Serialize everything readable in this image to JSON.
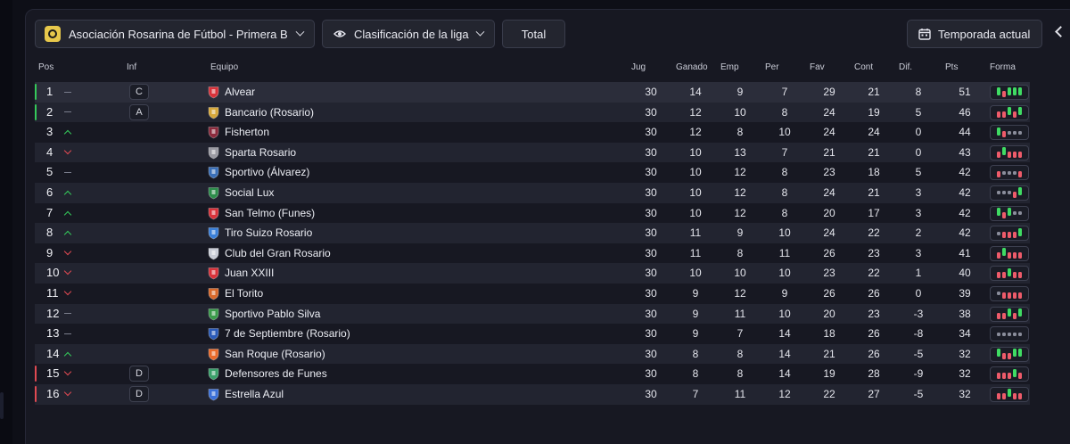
{
  "toolbar": {
    "league": "Asociación Rosarina de Fútbol - Primera B",
    "classification": "Clasificación de la liga",
    "total": "Total",
    "season": "Temporada actual"
  },
  "headers": {
    "pos": "Pos",
    "inf": "Inf",
    "team": "Equipo",
    "played": "Jug",
    "won": "Ganado",
    "drawn": "Emp",
    "lost": "Per",
    "gf": "Fav",
    "ga": "Cont",
    "gd": "Dif.",
    "pts": "Pts",
    "form": "Forma"
  },
  "colors": {
    "win": "#3fdc63",
    "loss": "#ee5b6a",
    "draw": "#8a8d9b",
    "promotion": "#35c95a",
    "relegation": "#e04a52"
  },
  "rows": [
    {
      "pos": "1",
      "trend": "same",
      "inf": "C",
      "team": "Alvear",
      "crest": "#d8323a",
      "jug": "30",
      "g": "14",
      "e": "9",
      "p": "7",
      "fav": "29",
      "cont": "21",
      "dif": "8",
      "pts": "51",
      "form": "WLWWW",
      "zone": "green"
    },
    {
      "pos": "2",
      "trend": "same",
      "inf": "A",
      "team": "Bancario (Rosario)",
      "crest": "#d6a73a",
      "jug": "30",
      "g": "12",
      "e": "10",
      "p": "8",
      "fav": "24",
      "cont": "19",
      "dif": "5",
      "pts": "46",
      "form": "LLWLW",
      "zone": "green"
    },
    {
      "pos": "3",
      "trend": "up",
      "inf": "",
      "team": "Fisherton",
      "crest": "#8b2a3c",
      "jug": "30",
      "g": "12",
      "e": "8",
      "p": "10",
      "fav": "24",
      "cont": "24",
      "dif": "0",
      "pts": "44",
      "form": "WLDDD",
      "zone": ""
    },
    {
      "pos": "4",
      "trend": "down",
      "inf": "",
      "team": "Sparta Rosario",
      "crest": "#9a9aa2",
      "jug": "30",
      "g": "10",
      "e": "13",
      "p": "7",
      "fav": "21",
      "cont": "21",
      "dif": "0",
      "pts": "43",
      "form": "LWLLL",
      "zone": ""
    },
    {
      "pos": "5",
      "trend": "same",
      "inf": "",
      "team": "Sportivo (Álvarez)",
      "crest": "#3a6fb8",
      "jug": "30",
      "g": "10",
      "e": "12",
      "p": "8",
      "fav": "23",
      "cont": "18",
      "dif": "5",
      "pts": "42",
      "form": "LDDDL",
      "zone": ""
    },
    {
      "pos": "6",
      "trend": "up",
      "inf": "",
      "team": "Social Lux",
      "crest": "#2c8c4a",
      "jug": "30",
      "g": "10",
      "e": "12",
      "p": "8",
      "fav": "24",
      "cont": "21",
      "dif": "3",
      "pts": "42",
      "form": "DDDLW",
      "zone": ""
    },
    {
      "pos": "7",
      "trend": "up",
      "inf": "",
      "team": "San Telmo (Funes)",
      "crest": "#d8323a",
      "jug": "30",
      "g": "10",
      "e": "12",
      "p": "8",
      "fav": "20",
      "cont": "17",
      "dif": "3",
      "pts": "42",
      "form": "WLWDD",
      "zone": ""
    },
    {
      "pos": "8",
      "trend": "up",
      "inf": "",
      "team": "Tiro Suizo Rosario",
      "crest": "#3a7fd8",
      "jug": "30",
      "g": "11",
      "e": "9",
      "p": "10",
      "fav": "24",
      "cont": "22",
      "dif": "2",
      "pts": "42",
      "form": "DLLLW",
      "zone": ""
    },
    {
      "pos": "9",
      "trend": "down",
      "inf": "",
      "team": "Club del Gran Rosario",
      "crest": "#c9ccd6",
      "jug": "30",
      "g": "11",
      "e": "8",
      "p": "11",
      "fav": "26",
      "cont": "23",
      "dif": "3",
      "pts": "41",
      "form": "LWLLL",
      "zone": ""
    },
    {
      "pos": "10",
      "trend": "down",
      "inf": "",
      "team": "Juan XXIII",
      "crest": "#d8323a",
      "jug": "30",
      "g": "10",
      "e": "10",
      "p": "10",
      "fav": "23",
      "cont": "22",
      "dif": "1",
      "pts": "40",
      "form": "LLWLL",
      "zone": ""
    },
    {
      "pos": "11",
      "trend": "down",
      "inf": "",
      "team": "El Torito",
      "crest": "#d8682a",
      "jug": "30",
      "g": "9",
      "e": "12",
      "p": "9",
      "fav": "26",
      "cont": "26",
      "dif": "0",
      "pts": "39",
      "form": "DLLLL",
      "zone": ""
    },
    {
      "pos": "12",
      "trend": "same",
      "inf": "",
      "team": "Sportivo Pablo Silva",
      "crest": "#3a9a4a",
      "jug": "30",
      "g": "9",
      "e": "11",
      "p": "10",
      "fav": "20",
      "cont": "23",
      "dif": "-3",
      "pts": "38",
      "form": "LLWLW",
      "zone": ""
    },
    {
      "pos": "13",
      "trend": "same",
      "inf": "",
      "team": "7 de Septiembre (Rosario)",
      "crest": "#2a5ab8",
      "jug": "30",
      "g": "9",
      "e": "7",
      "p": "14",
      "fav": "18",
      "cont": "26",
      "dif": "-8",
      "pts": "34",
      "form": "DDDDD",
      "zone": ""
    },
    {
      "pos": "14",
      "trend": "up",
      "inf": "",
      "team": "San Roque (Rosario)",
      "crest": "#e86a2a",
      "jug": "30",
      "g": "8",
      "e": "8",
      "p": "14",
      "fav": "21",
      "cont": "26",
      "dif": "-5",
      "pts": "32",
      "form": "WLLWW",
      "zone": ""
    },
    {
      "pos": "15",
      "trend": "down",
      "inf": "D",
      "team": "Defensores de Funes",
      "crest": "#3aa06a",
      "jug": "30",
      "g": "8",
      "e": "8",
      "p": "14",
      "fav": "19",
      "cont": "28",
      "dif": "-9",
      "pts": "32",
      "form": "LLLWL",
      "zone": "red"
    },
    {
      "pos": "16",
      "trend": "down",
      "inf": "D",
      "team": "Estrella Azul",
      "crest": "#3a6fd8",
      "jug": "30",
      "g": "7",
      "e": "11",
      "p": "12",
      "fav": "22",
      "cont": "27",
      "dif": "-5",
      "pts": "32",
      "form": "LLWLL",
      "zone": "red"
    }
  ]
}
